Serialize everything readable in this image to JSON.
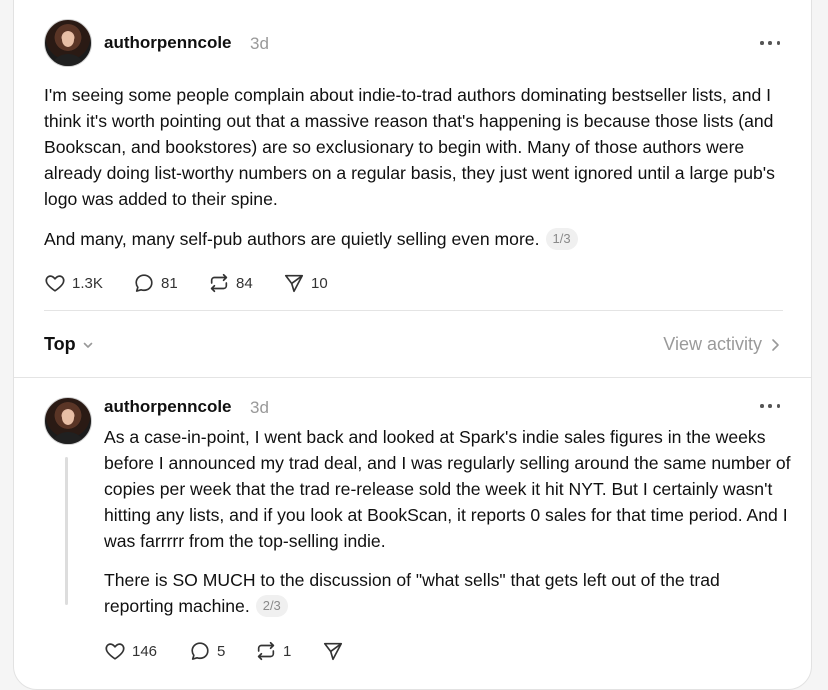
{
  "post": {
    "username": "authorpenncole",
    "time": "3d",
    "paragraphs": [
      "I'm seeing some people complain about indie-to-trad authors dominating bestseller lists, and I think it's worth pointing out that a massive reason that's happening is because those lists (and Bookscan, and bookstores) are so exclusionary to begin with. Many of those authors were already doing list-worthy numbers on a regular basis, they just went ignored until a large pub's logo was added to their spine.",
      "And many, many self-pub authors are quietly selling even more."
    ],
    "pager": "1/3",
    "likes": "1.3K",
    "replies": "81",
    "reposts": "84",
    "shares": "10"
  },
  "filter": {
    "label": "Top",
    "view_activity": "View activity"
  },
  "reply": {
    "username": "authorpenncole",
    "time": "3d",
    "paragraphs": [
      "As a case-in-point, I went back and looked at Spark's indie sales figures in the weeks before I announced my trad deal, and I was regularly selling around the same number of copies per week that the trad re-release sold the week it hit NYT. But I certainly wasn't hitting any lists, and if you look at BookScan, it reports 0 sales for that time period. And I was farrrrr from the top-selling indie.",
      "There is SO MUCH to the discussion of \"what sells\" that gets left out of the trad reporting machine."
    ],
    "pager": "2/3",
    "likes": "146",
    "replies": "5",
    "reposts": "1",
    "shares": ""
  }
}
